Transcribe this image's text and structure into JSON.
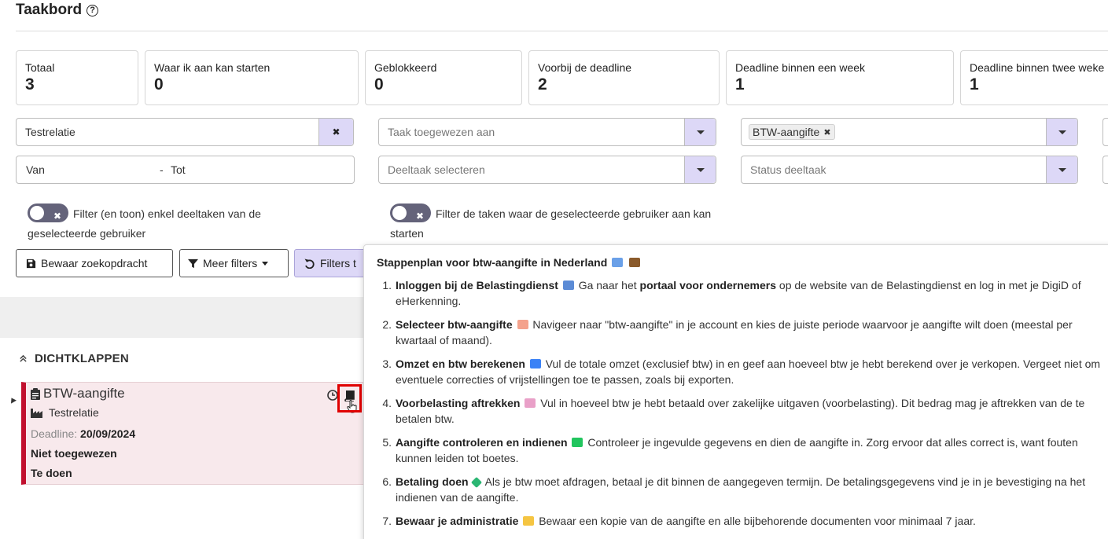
{
  "page": {
    "title": "Taakbord",
    "help_icon": "?"
  },
  "stats": [
    {
      "label": "Totaal",
      "value": "3"
    },
    {
      "label": "Waar ik aan kan starten",
      "value": "0"
    },
    {
      "label": "Geblokkeerd",
      "value": "0"
    },
    {
      "label": "Voorbij de deadline",
      "value": "2"
    },
    {
      "label": "Deadline binnen een week",
      "value": "1"
    },
    {
      "label": "Deadline binnen twee weke",
      "value": "1"
    }
  ],
  "filters": {
    "relation": {
      "value": "Testrelatie",
      "clear": "✖"
    },
    "assigned_to": {
      "placeholder": "Taak toegewezen aan"
    },
    "task_type": {
      "tag": "BTW-aangifte",
      "tag_remove": "✖"
    },
    "date_from": "Van",
    "date_sep": "-",
    "date_to": "Tot",
    "subtask": {
      "placeholder": "Deeltaak selecteren"
    },
    "subtask_status": {
      "placeholder": "Status deeltaak"
    },
    "toggle1_label": "Filter (en toon) enkel deeltaken van de geselecteerde gebruiker",
    "toggle2_label": "Filter de taken waar de geselecteerde gebruiker aan kan starten",
    "toggle_x": "✖"
  },
  "buttons": {
    "save_search": "Bewaar zoekopdracht",
    "more_filters": "Meer filters",
    "reset_filters": "Filters t"
  },
  "group": {
    "collapse_label": "DICHTKLAPPEN"
  },
  "task": {
    "title": "BTW-aangifte",
    "relation": "Testrelatie",
    "deadline_label": "Deadline:",
    "deadline_value": "20/09/2024",
    "assignee": "Niet toegewezen",
    "status": "Te doen"
  },
  "popup": {
    "title": "Stappenplan voor btw-aangifte in Nederland",
    "steps": [
      {
        "n": "1.",
        "bold": "Inloggen bij de Belastingdienst",
        "text1": "Ga naar het ",
        "bold2": "portaal voor ondernemers",
        "text2": " op de website van de Belastingdienst en log in met je DigiD of eHerkenning.",
        "emoji_color": "#5b8bd6"
      },
      {
        "n": "2.",
        "bold": "Selecteer btw-aangifte",
        "text1": "Navigeer naar \"btw-aangifte\" in je account en kies de juiste periode waarvoor je aangifte wilt doen (meestal per kwartaal of maand).",
        "bold2": "",
        "text2": "",
        "emoji_color": "#f4a28c"
      },
      {
        "n": "3.",
        "bold": "Omzet en btw berekenen",
        "text1": "Vul de totale omzet (exclusief btw) in en geef aan hoeveel btw je hebt berekend over je verkopen. Vergeet niet om eventuele correcties of vrijstellingen toe te passen, zoals bij exporten.",
        "bold2": "",
        "text2": "",
        "emoji_color": "#3b82f6"
      },
      {
        "n": "4.",
        "bold": "Voorbelasting aftrekken",
        "text1": "Vul in hoeveel btw je hebt betaald over zakelijke uitgaven (voorbelasting). Dit bedrag mag je aftrekken van de te betalen btw.",
        "bold2": "",
        "text2": "",
        "emoji_color": "#e9a0c8"
      },
      {
        "n": "5.",
        "bold": "Aangifte controleren en indienen",
        "text1": "Controleer je ingevulde gegevens en dien de aangifte in. Zorg ervoor dat alles correct is, want fouten kunnen leiden tot boetes.",
        "bold2": "",
        "text2": "",
        "emoji_color": "#22c55e"
      },
      {
        "n": "6.",
        "bold": "Betaling doen",
        "text1": "Als je btw moet afdragen, betaal je dit binnen de aangegeven termijn. De betalingsgegevens vind je in je bevestiging na het indienen van de aangifte.",
        "bold2": "",
        "text2": "",
        "emoji_color": "#2bb673"
      },
      {
        "n": "7.",
        "bold": "Bewaar je administratie",
        "text1": "Bewaar een kopie van de aangifte en alle bijbehorende documenten voor minimaal 7 jaar.",
        "bold2": "",
        "text2": "",
        "emoji_color": "#f5c542"
      }
    ]
  }
}
